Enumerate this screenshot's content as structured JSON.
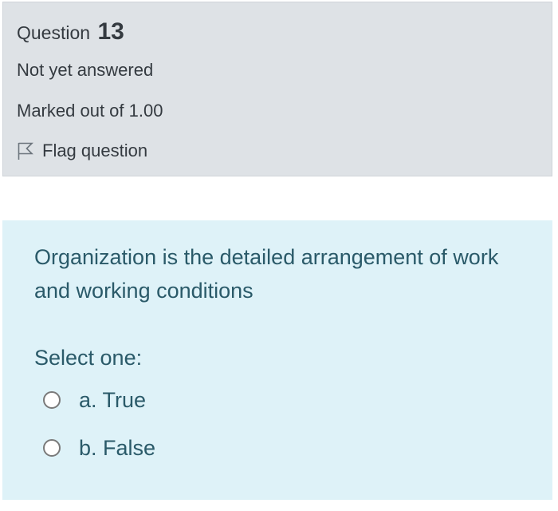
{
  "question_info": {
    "question_word": "Question",
    "question_number": "13",
    "status": "Not yet answered",
    "marks": "Marked out of 1.00",
    "flag_label": "Flag question",
    "flag_icon": "flag-outline-icon"
  },
  "question": {
    "text": "Organization is the detailed arrangement of work and working conditions",
    "prompt": "Select one:",
    "options": [
      {
        "label": "a. True",
        "selected": false
      },
      {
        "label": "b. False",
        "selected": false
      }
    ]
  },
  "colors": {
    "info_background": "#dee2e6",
    "content_background": "#def2f8",
    "question_text": "#2a5a69",
    "info_text": "#343a40"
  }
}
